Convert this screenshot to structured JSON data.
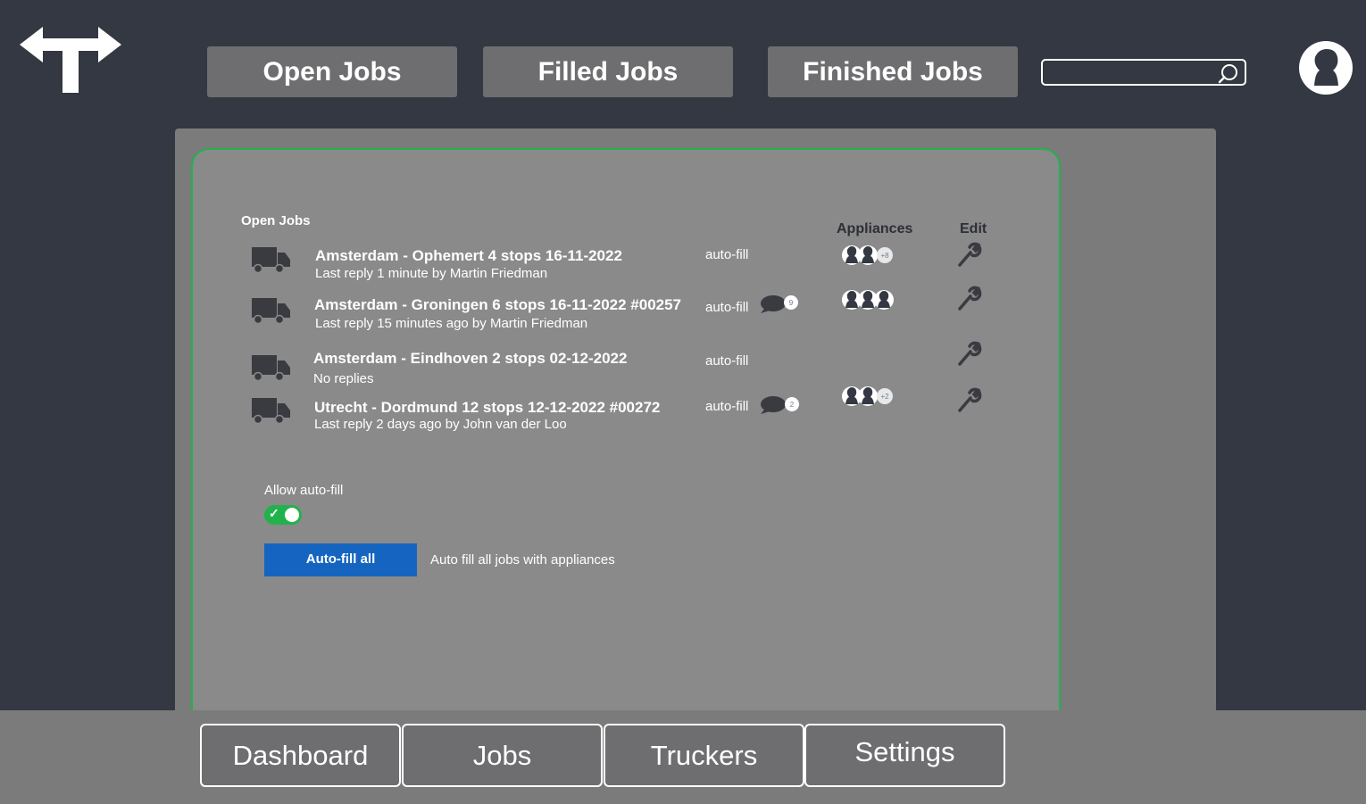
{
  "header": {
    "tabs": [
      {
        "label": "Open Jobs"
      },
      {
        "label": "Filled Jobs"
      },
      {
        "label": "Finished Jobs"
      }
    ],
    "search": {
      "placeholder": "",
      "value": ""
    },
    "logo_icon": "t-arrow-logo",
    "avatar_icon": "user-avatar-icon"
  },
  "jobs": {
    "section_title": "Open Jobs",
    "columns": {
      "appliances": "Appliances",
      "edit": "Edit"
    },
    "rows": [
      {
        "title": "Amsterdam - Ophemert 4 stops 16-11-2022",
        "subtitle": "Last reply 1 minute by Martin Friedman",
        "autofill": "auto-fill",
        "chat_count": "",
        "appliances_extra": "+8"
      },
      {
        "title": "Amsterdam - Groningen 6 stops 16-11-2022 #00257",
        "subtitle": "Last reply 15 minutes ago by Martin Friedman",
        "autofill": "auto-fill",
        "chat_count": "9",
        "appliances_extra": ""
      },
      {
        "title": "Amsterdam - Eindhoven 2 stops 02-12-2022",
        "subtitle": "No replies",
        "autofill": "auto-fill",
        "chat_count": "",
        "appliances_extra": ""
      },
      {
        "title": "Utrecht - Dordmund 12 stops 12-12-2022 #00272",
        "subtitle": "Last reply 2 days ago by John van der Loo",
        "autofill": "auto-fill",
        "chat_count": "2",
        "appliances_extra": "+2"
      }
    ]
  },
  "autofill": {
    "allow_label": "Allow auto-fill",
    "enabled": true,
    "button_label": "Auto-fill all",
    "description": "Auto fill all jobs with appliances"
  },
  "bottom_nav": [
    {
      "label": "Dashboard"
    },
    {
      "label": "Jobs"
    },
    {
      "label": "Truckers"
    },
    {
      "label": "Settings"
    }
  ],
  "colors": {
    "background": "#333842",
    "panel": "#7b7b7b",
    "card": "#8a8a8a",
    "card_border": "#22b24c",
    "tab": "#6e6e70",
    "primary_button": "#1565c0",
    "toggle_on": "#22b24c"
  }
}
